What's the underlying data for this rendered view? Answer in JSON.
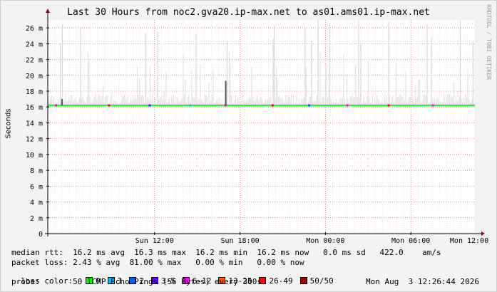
{
  "chart_data": {
    "type": "area",
    "title": "Last 30 Hours from noc2.gva20.ip-max.net to as01.ams01.ip-max.net",
    "ylabel": "Seconds",
    "ylim": [
      0,
      0.027
    ],
    "y_ticks": [
      0,
      0.002,
      0.004,
      0.006,
      0.008,
      0.01,
      0.012,
      0.014,
      0.016,
      0.018,
      0.02,
      0.022,
      0.024,
      0.026
    ],
    "y_tick_labels": [
      "0",
      "2 m",
      "4 m",
      "6 m",
      "8 m",
      "10 m",
      "12 m",
      "14 m",
      "16 m",
      "18 m",
      "20 m",
      "22 m",
      "24 m",
      "26 m"
    ],
    "x_ticks": [
      {
        "label": "Sun 12:00",
        "hours_from_start": 7.5
      },
      {
        "label": "Sun 18:00",
        "hours_from_start": 13.5
      },
      {
        "label": "Mon 00:00",
        "hours_from_start": 19.5
      },
      {
        "label": "Mon 06:00",
        "hours_from_start": 25.5
      },
      {
        "label": "Mon 12:00",
        "hours_from_start": 31.5
      }
    ],
    "x_hours": 30,
    "median_rtt_ms": 16.2,
    "smoke_max_ms": 27.0,
    "grid": true,
    "loss_spikes": [
      {
        "hour": 1.0,
        "value_ms": 17.0
      },
      {
        "hour": 12.5,
        "value_ms": 19.3
      }
    ]
  },
  "stats": {
    "median_rtt": "median rtt:  16.2 ms avg  16.3 ms max  16.2 ms min  16.2 ms now   0.0 ms sd   422.0    am/s",
    "packet_loss": "packet loss: 2.43 % avg  81.00 % max   0.00 % min   0.00 % now",
    "loss_color_label": "loss color:",
    "probe": "probe:       50 ICMP Echo Pings (56 Bytes) every 300s",
    "date": "Mon Aug  3 12:26:44 2026"
  },
  "loss_colors": [
    {
      "label": "0",
      "color": "#00ff00"
    },
    {
      "label": "1",
      "color": "#00b8ff"
    },
    {
      "label": "2",
      "color": "#0059ff"
    },
    {
      "label": "3-5",
      "color": "#5e00ff"
    },
    {
      "label": "6-12",
      "color": "#ff00fb"
    },
    {
      "label": "13-25",
      "color": "#ff5500"
    },
    {
      "label": "26-49",
      "color": "#ff0000"
    },
    {
      "label": "50/50",
      "color": "#a10000"
    }
  ],
  "watermark": "RRDTOOL / TOBI OETIKER"
}
